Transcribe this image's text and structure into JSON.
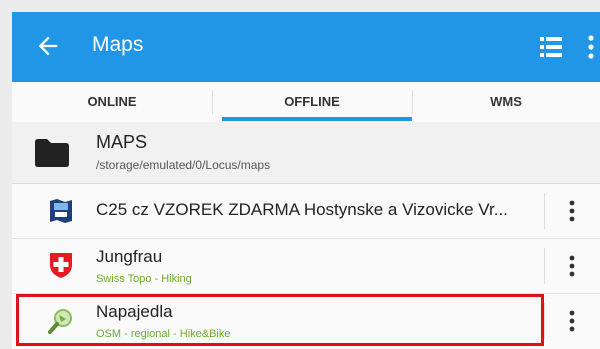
{
  "app_bar": {
    "title": "Maps",
    "back_icon": "arrow-left-icon",
    "list_icon": "list-view-icon",
    "more_icon": "more-vertical-icon",
    "color": "#2196e6"
  },
  "tabs": [
    {
      "label": "ONLINE",
      "selected": false
    },
    {
      "label": "OFFLINE",
      "selected": true
    },
    {
      "label": "WMS",
      "selected": false
    }
  ],
  "folder": {
    "name": "MAPS",
    "path": "/storage/emulated/0/Locus/maps",
    "icon": "folder-icon"
  },
  "maps": [
    {
      "name": "C25 cz VZOREK ZDARMA Hostynske a Vizovicke Vr...",
      "subtitle": "",
      "icon": "map-pack-icon"
    },
    {
      "name": "Jungfrau",
      "subtitle": "Swiss Topo - Hiking",
      "icon": "swiss-cross-icon"
    },
    {
      "name": "Napajedla",
      "subtitle": "OSM - regional - Hike&Bike",
      "icon": "magnifier-map-icon",
      "highlighted": true
    }
  ],
  "colors": {
    "subtitle": "#6cab2c",
    "highlight": "#e0101a"
  }
}
